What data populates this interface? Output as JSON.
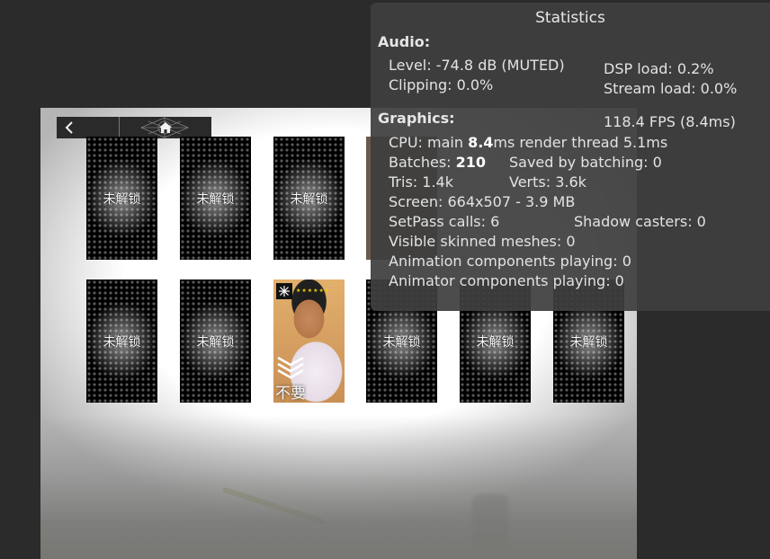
{
  "nav": {
    "back_icon": "chevron-left-icon",
    "home_icon": "home-icon"
  },
  "cards": {
    "locked_label": "未解锁",
    "photo_caption": "不要",
    "photo_stars": "★★★★★★"
  },
  "stats": {
    "title": "Statistics",
    "audio_heading": "Audio:",
    "level": "Level: -74.8 dB (MUTED)",
    "clipping": "Clipping: 0.0%",
    "dsp_load": "DSP load: 0.2%",
    "stream_load": "Stream load: 0.0%",
    "graphics_heading": "Graphics:",
    "fps": "118.4 FPS (8.4ms)",
    "cpu_prefix": "CPU: main ",
    "cpu_main": "8.4",
    "cpu_suffix": "ms  render thread 5.1ms",
    "batches_prefix": "Batches: ",
    "batches": "210",
    "saved_by_batching": "Saved by batching: 0",
    "tris": "Tris: 1.4k",
    "verts": "Verts: 3.6k",
    "screen": "Screen: 664x507 - 3.9 MB",
    "setpass": "SetPass calls: 6",
    "shadow_casters": "Shadow casters: 0",
    "skinned_meshes": "Visible skinned meshes: 0",
    "animation_components": "Animation components playing: 0",
    "animator_components": "Animator components playing: 0"
  },
  "colors": {
    "panel_bg": "#3e3e3e",
    "editor_bg": "#2b2b2b",
    "star_yellow": "#f0d000"
  }
}
